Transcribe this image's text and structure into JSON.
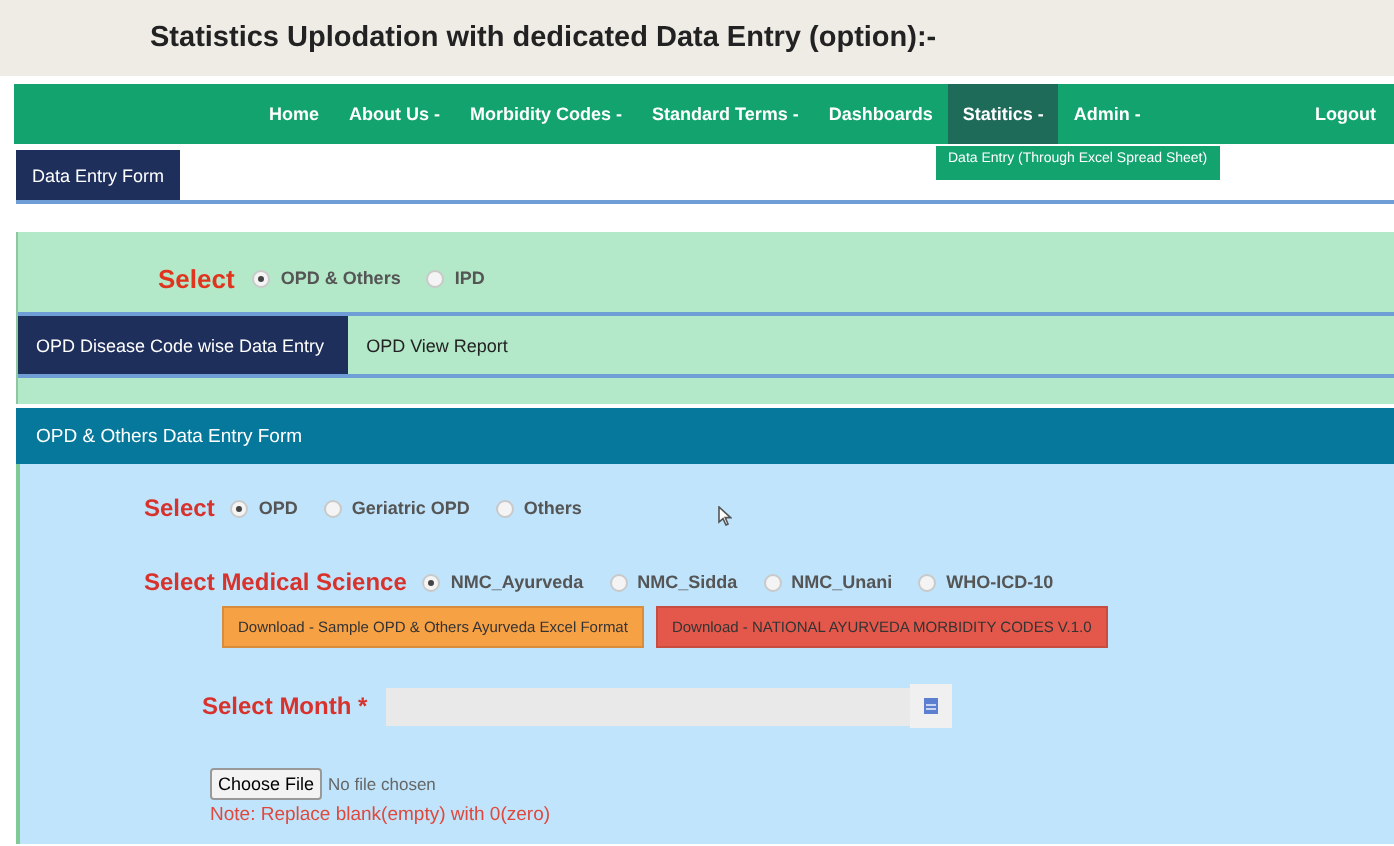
{
  "heading": "Statistics Uplodation with dedicated Data Entry (option):-",
  "nav": {
    "items": [
      {
        "label": "Home",
        "selected": false
      },
      {
        "label": "About Us -",
        "selected": false
      },
      {
        "label": "Morbidity Codes -",
        "selected": false
      },
      {
        "label": "Standard Terms -",
        "selected": false
      },
      {
        "label": "Dashboards",
        "selected": false
      },
      {
        "label": "Statitics -",
        "selected": true
      },
      {
        "label": "Admin -",
        "selected": false
      }
    ],
    "logout": "Logout",
    "dropdown": [
      "Data Entry (Through Excel Spread Sheet)"
    ]
  },
  "subnav": [
    {
      "label": "Data Entry Form",
      "selected": true
    }
  ],
  "type_select": {
    "label": "Select",
    "options": [
      {
        "label": "OPD & Others",
        "selected": true
      },
      {
        "label": "IPD",
        "selected": false
      }
    ]
  },
  "report_tabs": [
    {
      "label": "OPD Disease Code wise Data Entry",
      "selected": true
    },
    {
      "label": "OPD View Report",
      "selected": false
    }
  ],
  "form": {
    "title": "OPD & Others Data Entry Form",
    "category": {
      "label": "Select",
      "options": [
        {
          "label": "OPD",
          "selected": true
        },
        {
          "label": "Geriatric OPD",
          "selected": false
        },
        {
          "label": "Others",
          "selected": false
        }
      ]
    },
    "science": {
      "label": "Select Medical Science",
      "options": [
        {
          "label": "NMC_Ayurveda",
          "selected": true
        },
        {
          "label": "NMC_Sidda",
          "selected": false
        },
        {
          "label": "NMC_Unani",
          "selected": false
        },
        {
          "label": "WHO-ICD-10",
          "selected": false
        }
      ]
    },
    "downloads": [
      {
        "label": "Download - Sample OPD & Others Ayurveda Excel Format",
        "color": "#f7a145"
      },
      {
        "label": "Download - NATIONAL AYURVEDA MORBIDITY CODES V.1.0",
        "color": "#e4584b"
      }
    ],
    "month": {
      "label": "Select Month",
      "required_mark": "*"
    },
    "file": {
      "button": "Choose File",
      "status": "No file chosen"
    },
    "note": "Note: Replace blank(empty) with 0(zero)"
  }
}
